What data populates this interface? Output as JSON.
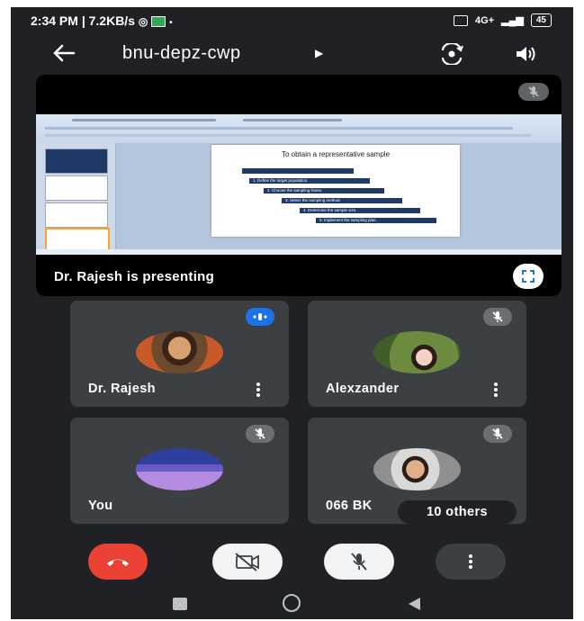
{
  "status_bar": {
    "time": "2:34 PM",
    "speed": "7.2KB/s",
    "network": "4G+",
    "battery": "45"
  },
  "meeting": {
    "title": "bnu-depz-cwp"
  },
  "icons": {
    "back": "arrow-left-icon",
    "title_caret": "caret-right-icon",
    "camera_switch": "camera-switch-icon",
    "speaker": "speaker-icon",
    "mic_off": "mic-off-icon",
    "speaking": "speaking-indicator-icon",
    "fullscreen": "fullscreen-icon",
    "more": "more-vert-icon",
    "end_call": "end-call-icon",
    "video_off": "video-off-icon"
  },
  "presentation": {
    "slide_title": "To obtain a representative sample",
    "steps": [
      "1. Define the target population.",
      "2. Choose the sampling frame.",
      "3. Select the sampling method.",
      "4. Determine the sample size.",
      "5. Implement the sampling plan."
    ],
    "presenter_label": "Dr. Rajesh is presenting"
  },
  "participants": [
    {
      "name": "Dr. Rajesh",
      "speaking": true
    },
    {
      "name": "Alexzander",
      "speaking": false
    },
    {
      "name": "You",
      "speaking": false
    },
    {
      "name": "066 BK",
      "speaking": false
    }
  ],
  "others_label": "10 others",
  "colors": {
    "background": "#202124",
    "tile": "#3c4043",
    "end_call": "#ea4335",
    "speaking": "#1a73e8"
  }
}
